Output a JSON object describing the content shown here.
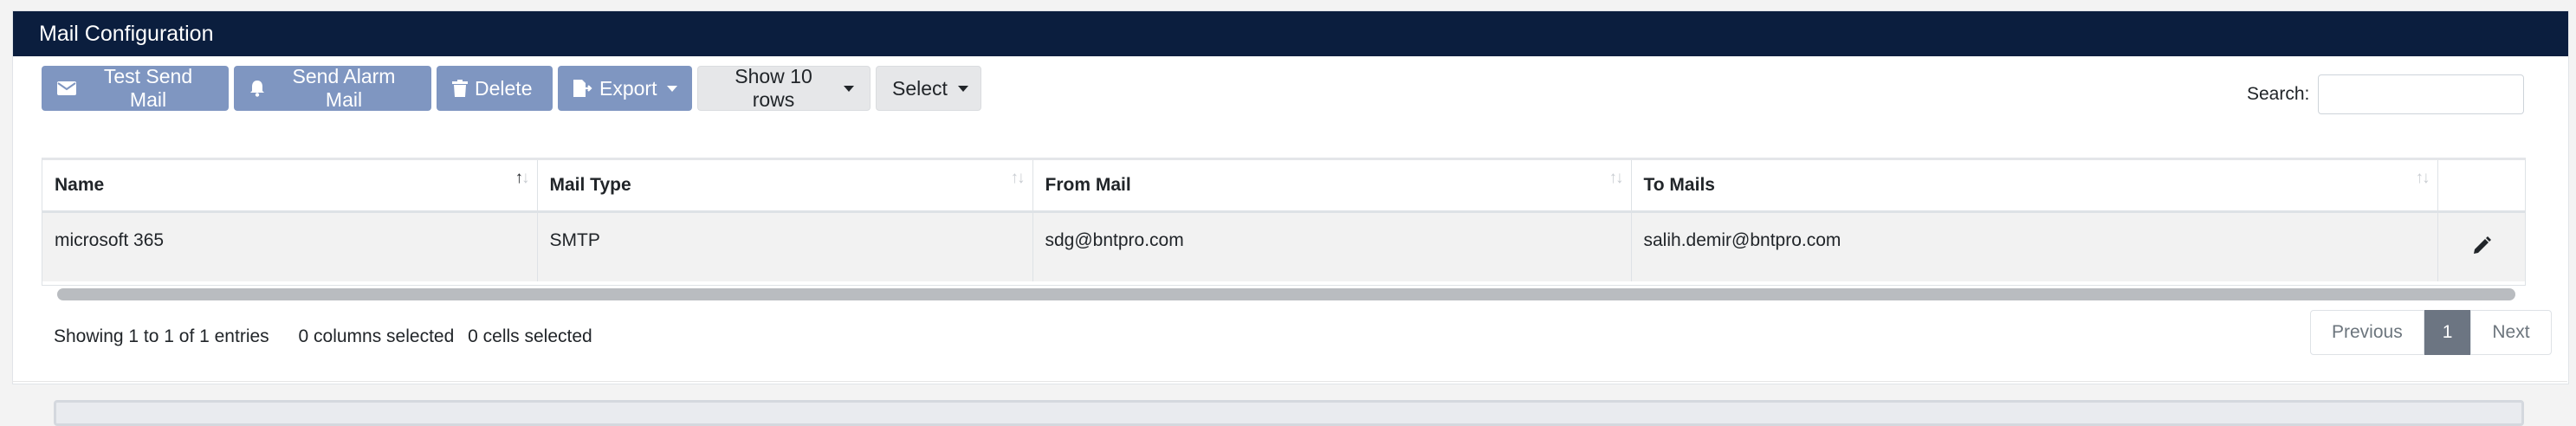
{
  "header": {
    "title": "Mail Configuration"
  },
  "toolbar": {
    "test_send": "Test Send Mail",
    "send_alarm": "Send Alarm Mail",
    "delete": "Delete",
    "export": "Export",
    "show_rows": "Show 10 rows",
    "select": "Select"
  },
  "search": {
    "label": "Search:",
    "value": "",
    "placeholder": ""
  },
  "table": {
    "columns": [
      "Name",
      "Mail Type",
      "From Mail",
      "To Mails"
    ],
    "rows": [
      [
        "microsoft 365",
        "SMTP",
        "sdg@bntpro.com",
        "salih.demir@bntpro.com"
      ]
    ]
  },
  "footer": {
    "entries": "Showing 1 to 1 of 1 entries",
    "columns_selected": "0 columns selected",
    "cells_selected": "0 cells selected"
  },
  "pagination": {
    "previous": "Previous",
    "current": "1",
    "next": "Next"
  },
  "colors": {
    "header_bg": "#0b1e3e",
    "button_blue": "#7f96c1",
    "active_page": "#6c7582"
  },
  "icons": [
    "envelope-icon",
    "bell-icon",
    "trash-icon",
    "file-export-icon",
    "pencil-icon"
  ]
}
